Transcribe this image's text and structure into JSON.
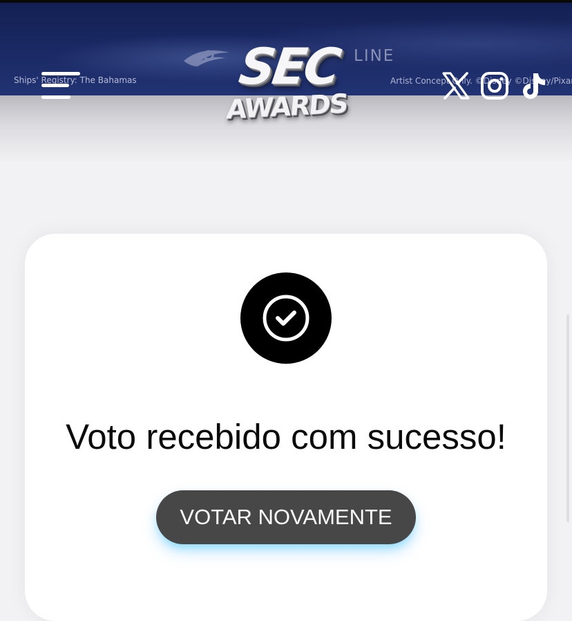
{
  "header": {
    "banner_registry_text": "Ships' Registry: The Bahamas",
    "banner_line_text": "LINE",
    "banner_concept_text": "Artist Concept Only. ©Disney ©Disney/Pixar",
    "logo": {
      "line1": "SEC",
      "line2": "AWARDS"
    },
    "menu_icon": "hamburger-menu-icon",
    "social_icons": [
      "x-icon",
      "instagram-icon",
      "tiktok-icon"
    ]
  },
  "confirmation": {
    "icon": "check-circle-icon",
    "message": "Voto recebido com sucesso!",
    "button_label": "VOTAR NOVAMENTE"
  },
  "colors": {
    "banner": "#1b2a66",
    "page_background": "#f2f2f5",
    "card_background": "#ffffff",
    "check_circle": "#000000",
    "button_background": "#474747",
    "button_glow": "#3ec8ff"
  }
}
